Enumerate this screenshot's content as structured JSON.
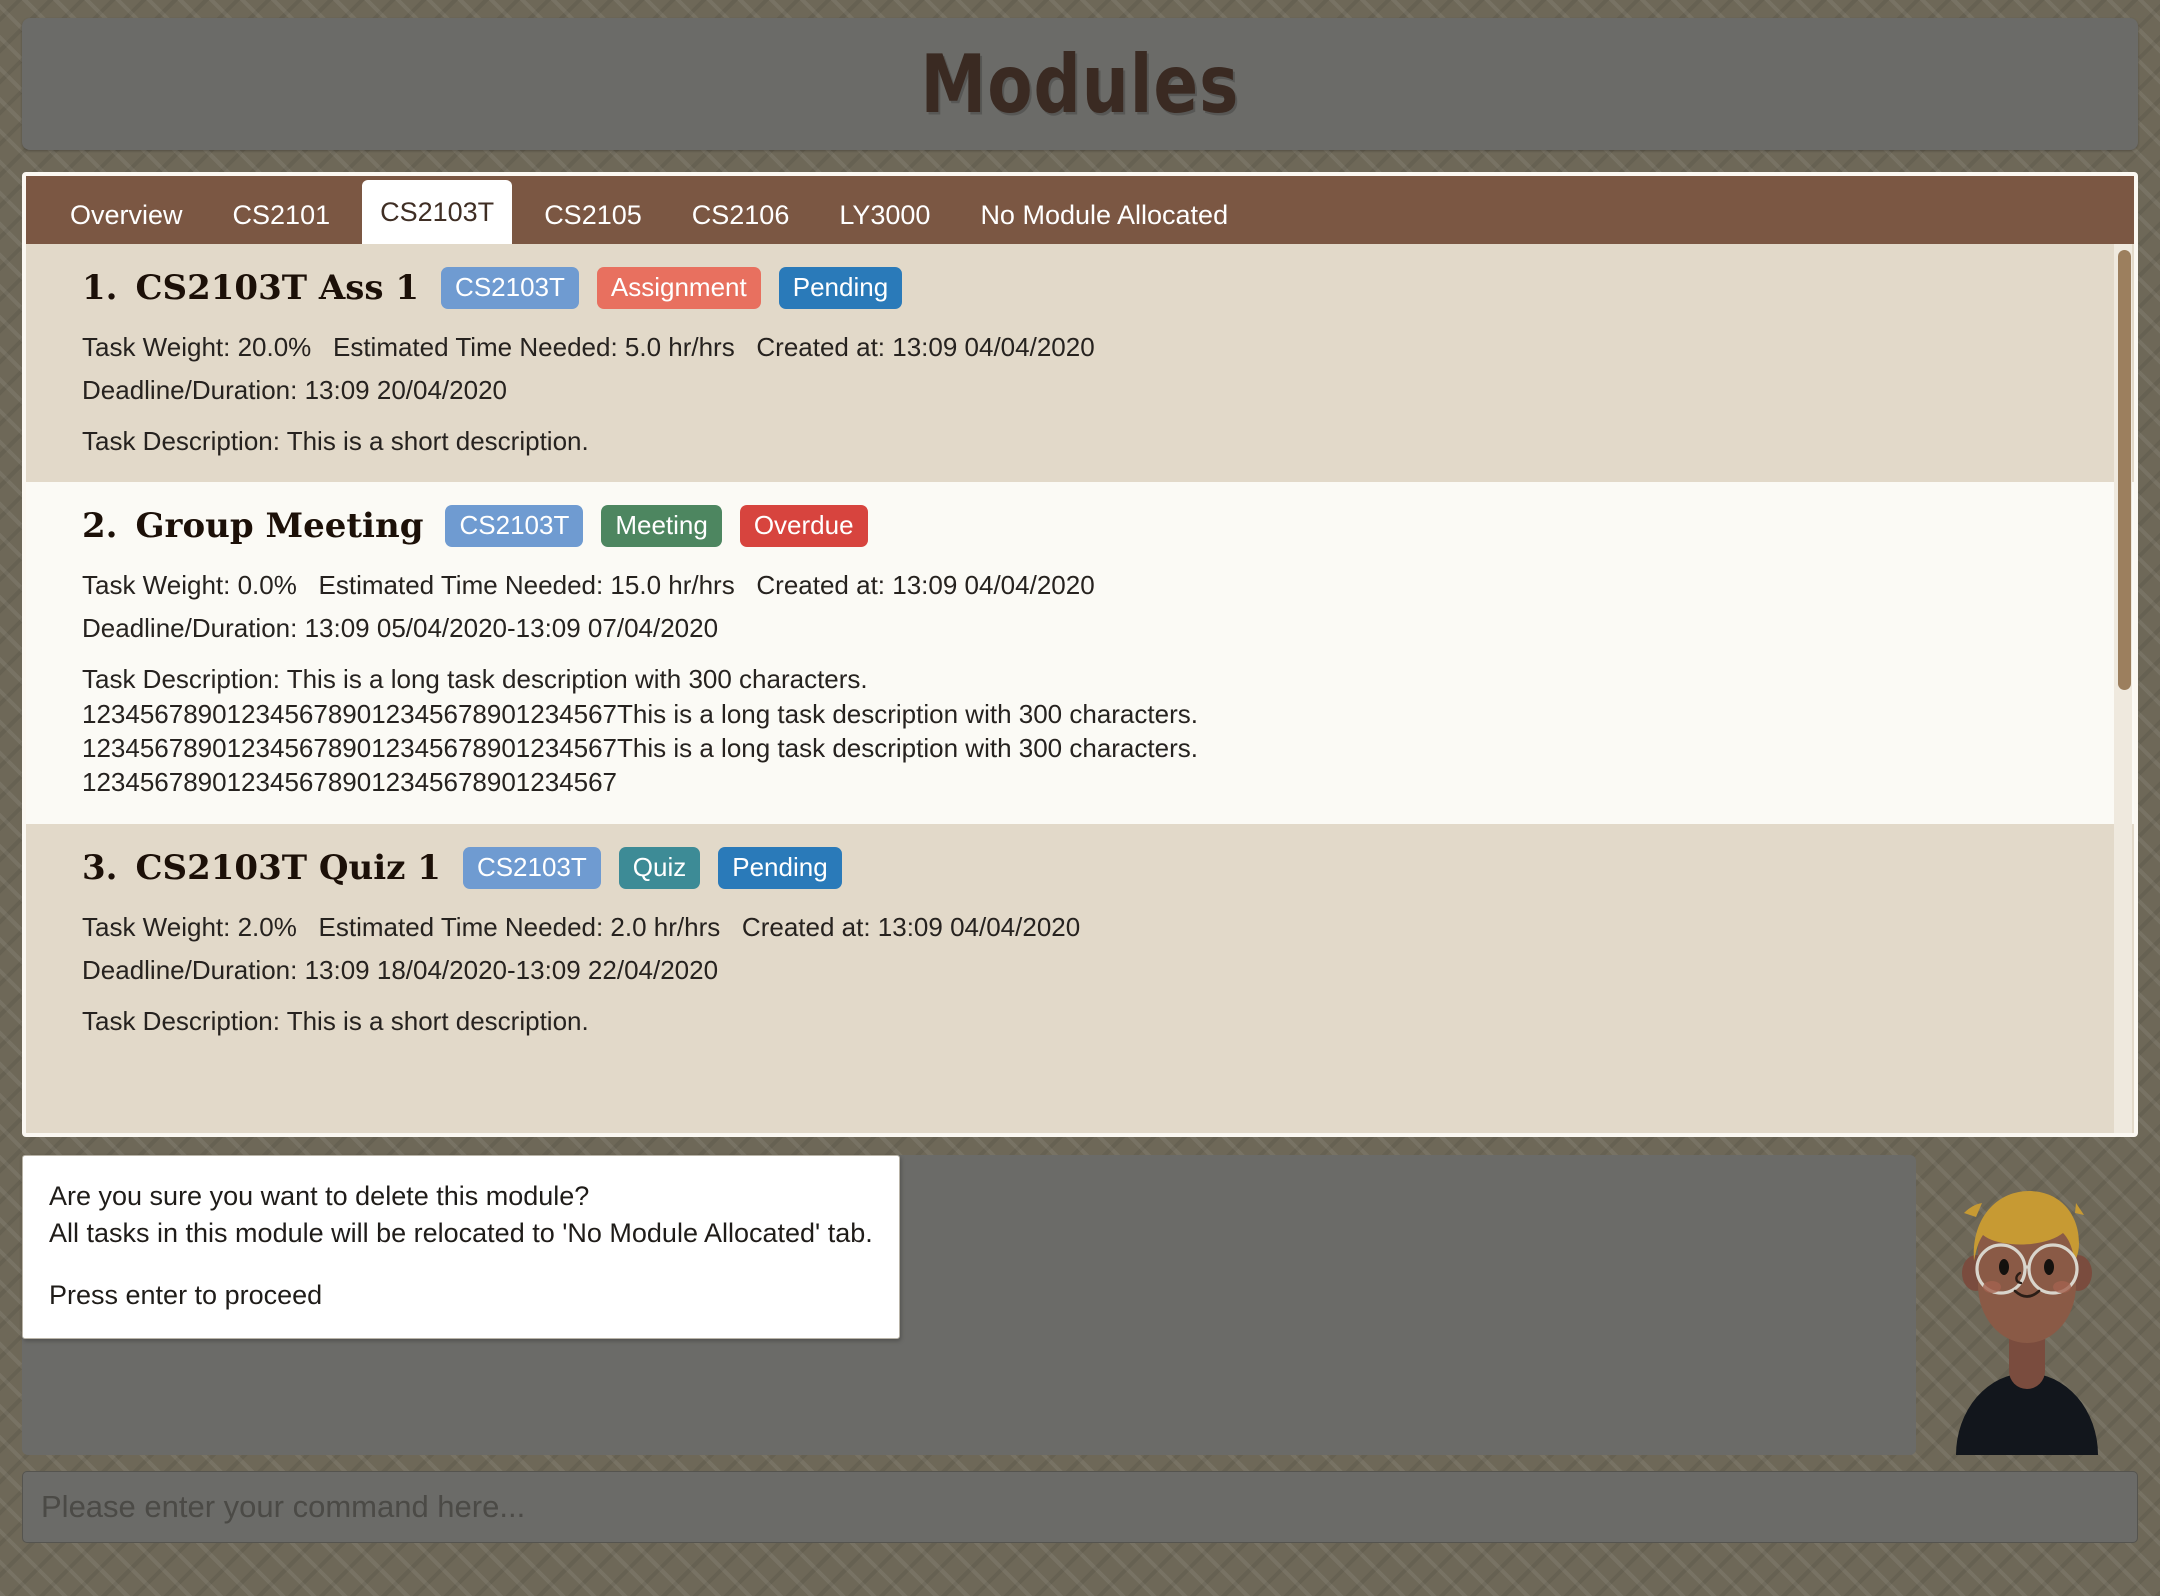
{
  "header": {
    "title": "Modules"
  },
  "tabs": [
    {
      "label": "Overview",
      "active": false
    },
    {
      "label": "CS2101",
      "active": false
    },
    {
      "label": "CS2103T",
      "active": true
    },
    {
      "label": "CS2105",
      "active": false
    },
    {
      "label": "CS2106",
      "active": false
    },
    {
      "label": "LY3000",
      "active": false
    },
    {
      "label": "No Module Allocated",
      "active": false
    }
  ],
  "colors": {
    "module_badge": "#6f9bd1",
    "assignment_badge": "#e8705f",
    "meeting_badge": "#4d8660",
    "quiz_badge": "#3d8b96",
    "pending_badge": "#2a7ab9",
    "overdue_badge": "#d7443e",
    "tabbar": "#7b5743",
    "panel_bg": "#e2d9c9",
    "row_alt_bg": "#fbfaf5",
    "title_text": "#3a2a22"
  },
  "tasks": [
    {
      "index": "1.",
      "title": "CS2103T Ass 1",
      "badges": [
        {
          "label": "CS2103T",
          "kind": "module"
        },
        {
          "label": "Assignment",
          "kind": "assignment"
        },
        {
          "label": "Pending",
          "kind": "pending"
        }
      ],
      "meta1": "Task Weight: 20.0%   Estimated Time Needed: 5.0 hr/hrs   Created at: 13:09 04/04/2020",
      "meta2": "Deadline/Duration: 13:09 20/04/2020",
      "description": "Task Description: This is a short description."
    },
    {
      "index": "2.",
      "title": "Group Meeting",
      "badges": [
        {
          "label": "CS2103T",
          "kind": "module"
        },
        {
          "label": "Meeting",
          "kind": "meeting"
        },
        {
          "label": "Overdue",
          "kind": "overdue"
        }
      ],
      "meta1": "Task Weight: 0.0%   Estimated Time Needed: 15.0 hr/hrs   Created at: 13:09 04/04/2020",
      "meta2": "Deadline/Duration: 13:09 05/04/2020-13:09 07/04/2020",
      "description": "Task Description: This is a long task description with 300 characters.\n1234567890123456789012345678901234567This is a long task description with 300 characters.\n1234567890123456789012345678901234567This is a long task description with 300 characters.\n1234567890123456789012345678901234567"
    },
    {
      "index": "3.",
      "title": "CS2103T Quiz 1",
      "badges": [
        {
          "label": "CS2103T",
          "kind": "module"
        },
        {
          "label": "Quiz",
          "kind": "quiz"
        },
        {
          "label": "Pending",
          "kind": "pending"
        }
      ],
      "meta1": "Task Weight: 2.0%   Estimated Time Needed: 2.0 hr/hrs   Created at: 13:09 04/04/2020",
      "meta2": "Deadline/Duration: 13:09 18/04/2020-13:09 22/04/2020",
      "description": "Task Description: This is a short description."
    }
  ],
  "dialog": {
    "line1": "Are you sure you want to delete this module?",
    "line2": "All tasks in this module will be relocated to 'No Module Allocated' tab.",
    "line3": "Press enter to proceed"
  },
  "command": {
    "value": "",
    "placeholder": "Please enter your command here..."
  },
  "avatar": {
    "name": "student-avatar"
  }
}
